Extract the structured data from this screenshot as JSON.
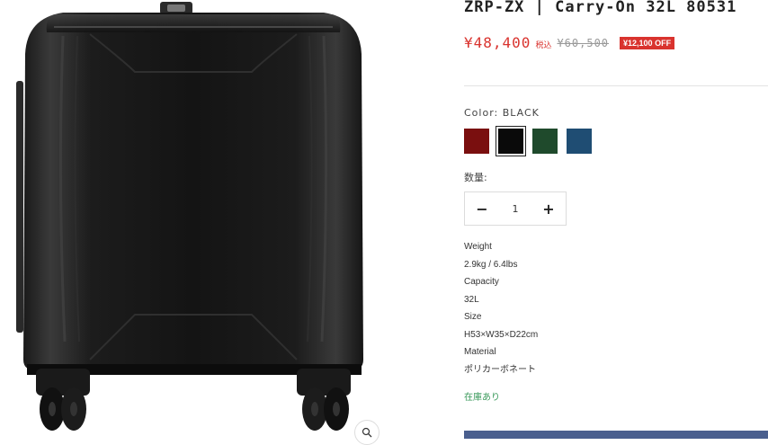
{
  "product": {
    "title": "ZRP-ZX | Carry-On 32L 80531",
    "price": "¥48,400",
    "tax_label": "税込",
    "old_price": "¥60,500",
    "discount_badge": "¥12,100 OFF"
  },
  "color": {
    "label": "Color:  BLACK",
    "swatches": [
      {
        "name": "red",
        "hex": "#7a0f0f",
        "selected": false
      },
      {
        "name": "black",
        "hex": "#0a0a0a",
        "selected": true
      },
      {
        "name": "green",
        "hex": "#1f4a2c",
        "selected": false
      },
      {
        "name": "blue",
        "hex": "#1f4d73",
        "selected": false
      }
    ]
  },
  "quantity": {
    "label": "数量:",
    "minus": "−",
    "value": "1",
    "plus": "+"
  },
  "specs": [
    "Weight",
    "2.9kg / 6.4lbs",
    "Capacity",
    "32L",
    "Size",
    "H53×W35×D22cm",
    "Material",
    "ポリカーボネート"
  ],
  "stock_status": "在庫あり",
  "icons": {
    "zoom": "zoom-icon"
  },
  "colors": {
    "accent_red": "#d9332e",
    "stock_green": "#3a9a5b",
    "cart_button": "#4a5f8e"
  }
}
